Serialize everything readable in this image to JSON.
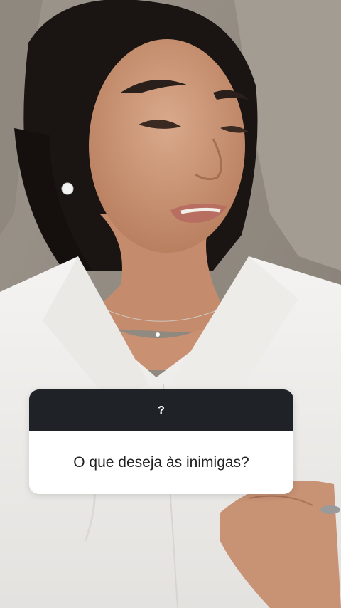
{
  "story_photo": {
    "description_icon": "portrait-photo"
  },
  "question_sticker": {
    "header_symbol": "?",
    "question": "O que deseja às inimigas?",
    "header_color": "#1f2327",
    "body_color": "#ffffff"
  }
}
